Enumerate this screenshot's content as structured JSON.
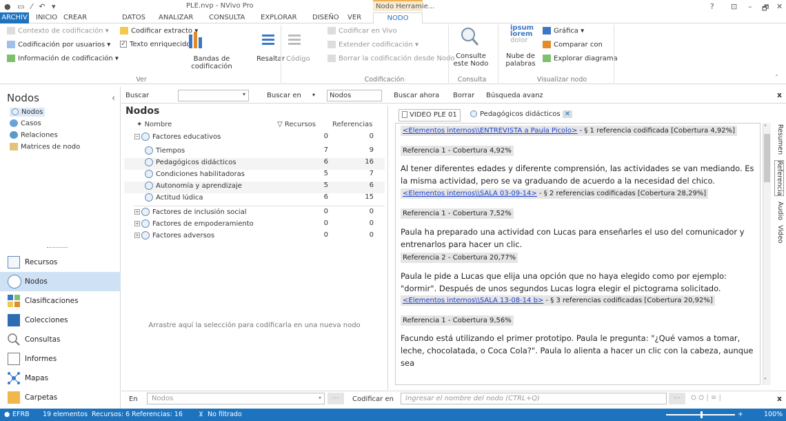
{
  "window": {
    "title": "PLE.nvp - NVivo Pro",
    "context_tab": "Nodo Herramie...",
    "help": "?",
    "controls": [
      "⊡",
      "–",
      "🗗",
      "✕"
    ]
  },
  "tabs": [
    "ARCHIV",
    "INICIO",
    "CREAR",
    "DATOS",
    "ANALIZAR",
    "CONSULTA",
    "EXPLORAR",
    "DISEÑO",
    "VER",
    "NODO"
  ],
  "ribbon": {
    "ver": {
      "group": "Ver",
      "items": [
        "Contexto de codificación",
        "Codificación por usuarios",
        "Información de codificación",
        "Codificar extracto",
        "Texto enriquecido"
      ],
      "bandas": "Bandas de codificación",
      "resaltar": "Resaltar"
    },
    "codificacion": {
      "group": "Codificación",
      "codigo": "Código",
      "items": [
        "Codificar en Vivo",
        "Extender codificación",
        "Borrar la codificación desde Nodo"
      ]
    },
    "consulta": {
      "group": "Consulta",
      "btn": "Consulte este Nodo"
    },
    "visualizar": {
      "group": "Visualizar nodo",
      "nube": "Nube de palabras",
      "items": [
        "Gráfica",
        "Comparar con",
        "Explorar diagrama"
      ]
    }
  },
  "left": {
    "title": "Nodos",
    "tree": [
      "Nodos",
      "Casos",
      "Relaciones",
      "Matrices de nodo"
    ],
    "nav": [
      "Recursos",
      "Nodos",
      "Clasificaciones",
      "Colecciones",
      "Consultas",
      "Informes",
      "Mapas",
      "Carpetas"
    ]
  },
  "search": {
    "buscar": "Buscar",
    "buscar_en": "Buscar en",
    "scope": "Nodos",
    "ahora": "Buscar ahora",
    "borrar": "Borrar",
    "avanzada": "Búsqueda avanz",
    "close": "x"
  },
  "grid": {
    "title": "Nodos",
    "cols": [
      "Nombre",
      "Recursos",
      "Referencias"
    ],
    "rows": [
      {
        "name": "Factores educativos",
        "rec": "0",
        "ref": "0",
        "lvl": 0
      },
      {
        "name": "Tiempos",
        "rec": "7",
        "ref": "9",
        "lvl": 1
      },
      {
        "name": "Pedagógicos didácticos",
        "rec": "6",
        "ref": "16",
        "lvl": 1
      },
      {
        "name": "Condiciones habilitadoras",
        "rec": "5",
        "ref": "7",
        "lvl": 1
      },
      {
        "name": "Autonomía y aprendizaje",
        "rec": "5",
        "ref": "6",
        "lvl": 1
      },
      {
        "name": "Actitud lúdica",
        "rec": "6",
        "ref": "15",
        "lvl": 1
      },
      {
        "name": "Factores de inclusión social",
        "rec": "0",
        "ref": "0",
        "lvl": 0
      },
      {
        "name": "Factores de empoderamiento",
        "rec": "0",
        "ref": "0",
        "lvl": 0
      },
      {
        "name": "Factores adversos",
        "rec": "0",
        "ref": "0",
        "lvl": 0
      }
    ],
    "drop_hint": "Arrastre aquí la selección para codificarla en una nueva nodo"
  },
  "doc": {
    "tabs": [
      "VIDEO PLE 01",
      "Pedagógicos didácticos"
    ],
    "blocks": [
      {
        "link": "<Elementos internos\\\\ENTREVISTA a Paula Picolo>",
        "rest": " - § 1 referencia codificada  [Cobertura 4,92%]"
      },
      {
        "ref": "Referencia 1 - Cobertura 4,92%"
      },
      {
        "text": "Al tener diferentes edades y diferente comprensión, las actividades se van mediando. Es la misma actividad, pero se va graduando de acuerdo a la necesidad del chico."
      },
      {
        "link": "<Elementos internos\\\\SALA 03-09-14>",
        "rest": " - § 2 referencias codificadas  [Cobertura 28,29%]"
      },
      {
        "ref": "Referencia 1 - Cobertura 7,52%"
      },
      {
        "text": "Paula ha preparado una actividad con Lucas para enseñarles el uso del comunicador y entrenarlos para hacer un clic."
      },
      {
        "ref": "Referencia 2 - Cobertura 20,77%"
      },
      {
        "text": "Paula le pide a Lucas que elija una opción que no haya elegido como por ejemplo: \"dormir\". Después de unos segundos Lucas logra elegir el pictograma solicitado."
      },
      {
        "link": "<Elementos internos\\\\SALA 13-08-14 b>",
        "rest": " - § 3 referencias codificadas  [Cobertura 20,92%]"
      },
      {
        "ref": "Referencia 1 - Cobertura 9,56%"
      },
      {
        "text": "Facundo está utilizando el primer prototipo. Paula le pregunta: \"¿Qué vamos a tomar, leche, chocolatada, o Coca Cola?\". Paula lo alienta a hacer un clic con la cabeza, aunque sea"
      }
    ],
    "vtabs": [
      "Resumen",
      "Referencia",
      "Audio",
      "Video"
    ]
  },
  "codebar": {
    "en": "En",
    "scope": "Nodos",
    "codificar": "Codificar en",
    "placeholder": "Ingresar el nombre del nodo (CTRL+Q)",
    "close": "x"
  },
  "status": {
    "user": "EFRB",
    "items": "19 elementos",
    "recursos": "Recursos: 6  Referencias: 16",
    "filter": "No filtrado",
    "zoom": "100%"
  }
}
